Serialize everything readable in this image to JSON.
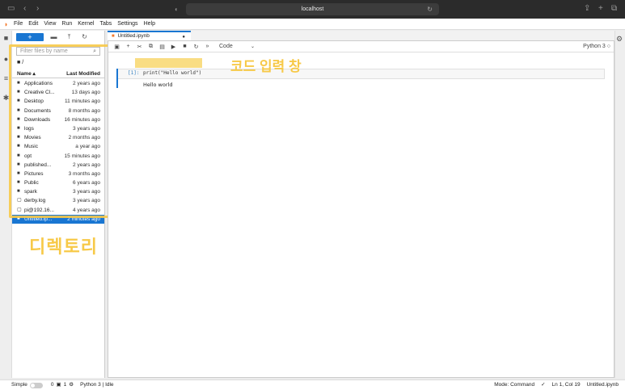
{
  "browser": {
    "url": "localhost"
  },
  "menu": [
    "File",
    "Edit",
    "View",
    "Run",
    "Kernel",
    "Tabs",
    "Settings",
    "Help"
  ],
  "filebrowser": {
    "new_label": "+",
    "filter_placeholder": "Filter files by name",
    "breadcrumb": "/",
    "col_name": "Name",
    "col_modified": "Last Modified",
    "rows": [
      {
        "icon": "folder-icon",
        "name": "Applications",
        "modified": "2 years ago"
      },
      {
        "icon": "folder-icon",
        "name": "Creative Cl...",
        "modified": "13 days ago"
      },
      {
        "icon": "folder-icon",
        "name": "Desktop",
        "modified": "11 minutes ago"
      },
      {
        "icon": "folder-icon",
        "name": "Documents",
        "modified": "8 months ago"
      },
      {
        "icon": "folder-icon",
        "name": "Downloads",
        "modified": "16 minutes ago"
      },
      {
        "icon": "folder-icon",
        "name": "logs",
        "modified": "3 years ago"
      },
      {
        "icon": "folder-icon",
        "name": "Movies",
        "modified": "2 months ago"
      },
      {
        "icon": "folder-icon",
        "name": "Music",
        "modified": "a year ago"
      },
      {
        "icon": "folder-icon",
        "name": "opt",
        "modified": "15 minutes ago"
      },
      {
        "icon": "folder-icon",
        "name": "published...",
        "modified": "2 years ago"
      },
      {
        "icon": "folder-icon",
        "name": "Pictures",
        "modified": "3 months ago"
      },
      {
        "icon": "folder-icon",
        "name": "Public",
        "modified": "6 years ago"
      },
      {
        "icon": "folder-icon",
        "name": "spark",
        "modified": "3 years ago"
      },
      {
        "icon": "file-icon",
        "name": "derby.log",
        "modified": "3 years ago"
      },
      {
        "icon": "file-icon",
        "name": "pi@192.16...",
        "modified": "4 years ago"
      },
      {
        "icon": "notebook-icon",
        "name": "Untitled.ip...",
        "modified": "2 minutes ago",
        "selected": true
      }
    ]
  },
  "annotations": {
    "directory_label": "디렉토리",
    "code_label": "코드 입력 창"
  },
  "notebook": {
    "tab_title": "Untitled.ipynb",
    "cell_type": "Code",
    "kernel": "Python 3",
    "prompt": "[1]:",
    "code": "print(\"Hello world\")",
    "output": "Hello world"
  },
  "statusbar": {
    "mode_label": "Simple",
    "count_a": "0",
    "count_b": "1",
    "kernel_status": "Python 3 | Idle",
    "mode": "Mode: Command",
    "cursor": "Ln 1, Col 19",
    "file": "Untitled.ipynb"
  },
  "colors": {
    "accent": "#1976d2",
    "highlight": "#f7c948",
    "jupyter": "#f37626"
  }
}
